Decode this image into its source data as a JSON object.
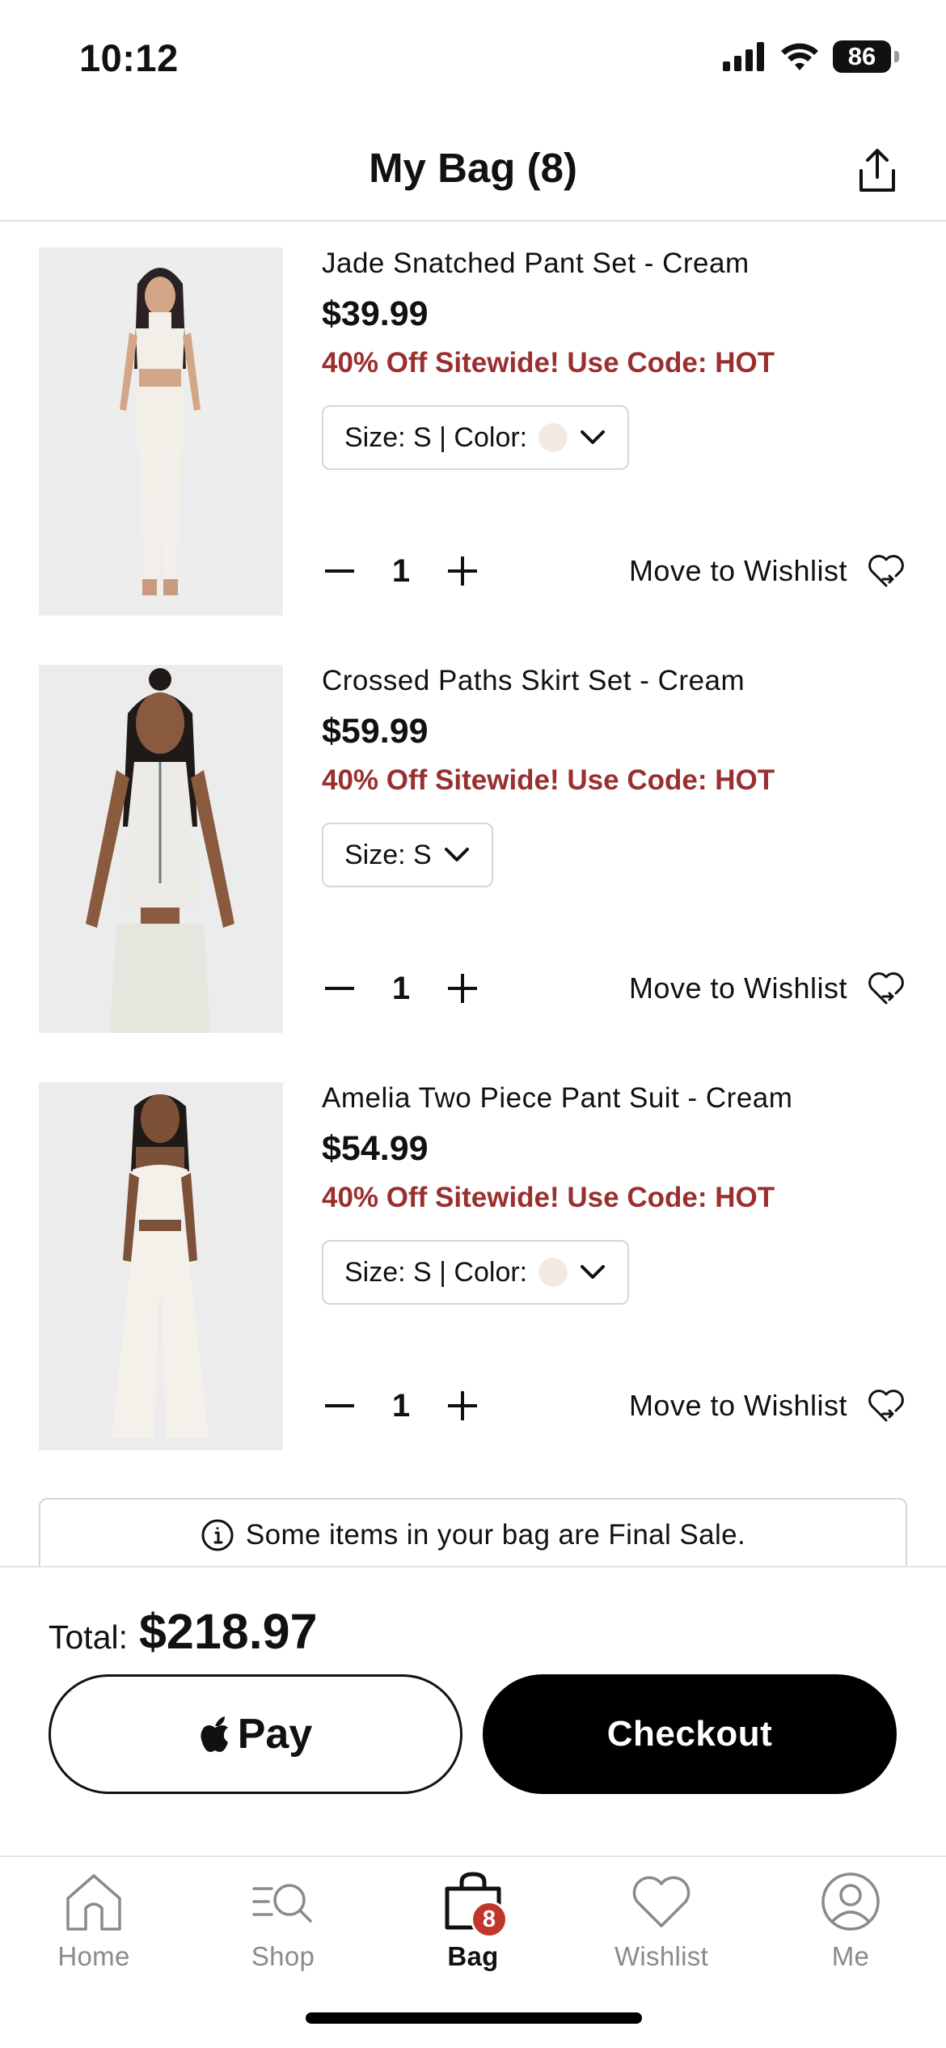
{
  "status_bar": {
    "time": "10:12",
    "battery": "86"
  },
  "header": {
    "title": "My Bag (8)",
    "share_icon": "share-icon"
  },
  "items": [
    {
      "name": "Jade Snatched Pant Set - Cream",
      "price": "$39.99",
      "promo": "40% Off Sitewide! Use Code: HOT",
      "variant": "Size: S | Color:",
      "has_color": true,
      "color": "#f3e9e1",
      "quantity": "1",
      "wishlist_label": "Move to Wishlist"
    },
    {
      "name": "Crossed Paths Skirt Set - Cream",
      "price": "$59.99",
      "promo": "40% Off Sitewide! Use Code: HOT",
      "variant": "Size: S",
      "has_color": false,
      "quantity": "1",
      "wishlist_label": "Move to Wishlist"
    },
    {
      "name": "Amelia Two Piece Pant Suit - Cream",
      "price": "$54.99",
      "promo": "40% Off Sitewide! Use Code: HOT",
      "variant": "Size: S | Color:",
      "has_color": true,
      "color": "#f3e9e1",
      "quantity": "1",
      "wishlist_label": "Move to Wishlist"
    }
  ],
  "notice": {
    "text": "Some items in your bag are Final Sale."
  },
  "checkout": {
    "total_label": "Total:",
    "total_value": "$218.97",
    "apple_pay_label": "Pay",
    "checkout_label": "Checkout"
  },
  "tabs": [
    {
      "label": "Home",
      "icon": "home-icon",
      "active": false
    },
    {
      "label": "Shop",
      "icon": "shop-search-icon",
      "active": false
    },
    {
      "label": "Bag",
      "icon": "bag-icon",
      "active": true,
      "badge": "8"
    },
    {
      "label": "Wishlist",
      "icon": "heart-icon",
      "active": false
    },
    {
      "label": "Me",
      "icon": "profile-icon",
      "active": false
    }
  ],
  "colors": {
    "promo": "#9a2f2f",
    "badge": "#c0362c",
    "accent": "#000000"
  }
}
